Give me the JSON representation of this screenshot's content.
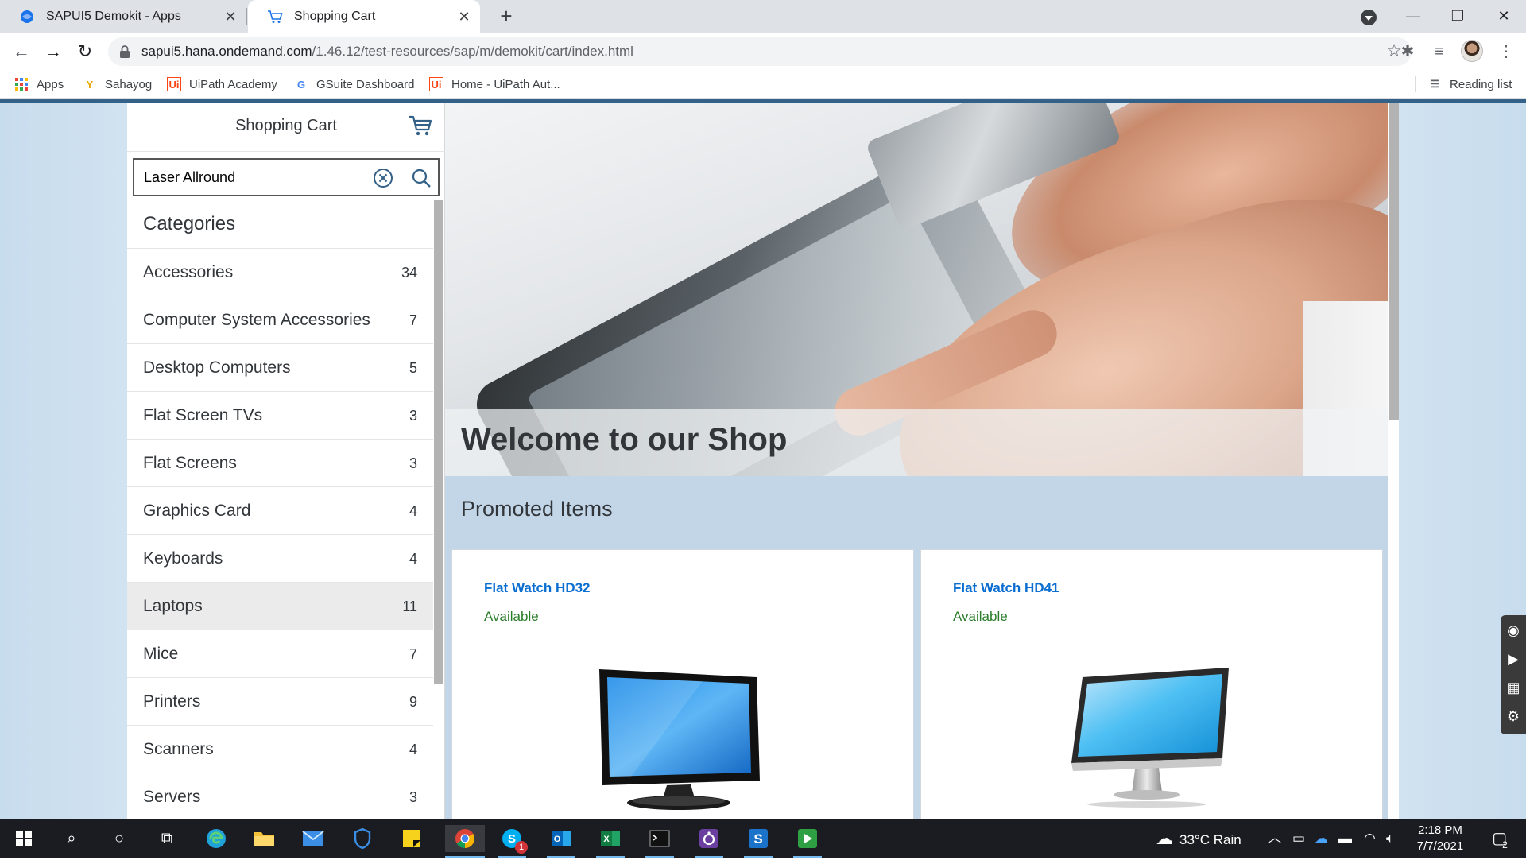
{
  "browser": {
    "tabs": [
      {
        "title": "SAPUI5 Demokit - Apps",
        "icon": "globe-icon"
      },
      {
        "title": "Shopping Cart",
        "icon": "cart-icon"
      }
    ],
    "url_host": "sapui5.hana.ondemand.com",
    "url_path": "/1.46.12/test-resources/sap/m/demokit/cart/index.html",
    "bookmarks": [
      {
        "label": "Apps"
      },
      {
        "label": "Sahayog"
      },
      {
        "label": "UiPath Academy"
      },
      {
        "label": "GSuite Dashboard"
      },
      {
        "label": "Home - UiPath Aut..."
      }
    ],
    "reading_list": "Reading list"
  },
  "master": {
    "title": "Shopping Cart",
    "search_value": "Laser Allround",
    "list_header": "Categories",
    "categories": [
      {
        "name": "Accessories",
        "count": "34"
      },
      {
        "name": "Computer System Accessories",
        "count": "7"
      },
      {
        "name": "Desktop Computers",
        "count": "5"
      },
      {
        "name": "Flat Screen TVs",
        "count": "3"
      },
      {
        "name": "Flat Screens",
        "count": "3"
      },
      {
        "name": "Graphics Card",
        "count": "4"
      },
      {
        "name": "Keyboards",
        "count": "4"
      },
      {
        "name": "Laptops",
        "count": "11"
      },
      {
        "name": "Mice",
        "count": "7"
      },
      {
        "name": "Printers",
        "count": "9"
      },
      {
        "name": "Scanners",
        "count": "4"
      },
      {
        "name": "Servers",
        "count": "3"
      }
    ],
    "selected_category": "Laptops"
  },
  "detail": {
    "welcome": "Welcome to our Shop",
    "promoted_title": "Promoted Items",
    "products": [
      {
        "name": "Flat Watch HD32",
        "status": "Available"
      },
      {
        "name": "Flat Watch HD41",
        "status": "Available"
      }
    ]
  },
  "colors": {
    "link": "#0a6ed1",
    "available": "#2b7d2b",
    "shell_bar": "#346187",
    "detail_bg": "#c2d6e8"
  },
  "taskbar": {
    "weather": "33°C  Rain",
    "time": "2:18 PM",
    "date": "7/7/2021",
    "notifications": "2",
    "skype_badge": "1"
  }
}
